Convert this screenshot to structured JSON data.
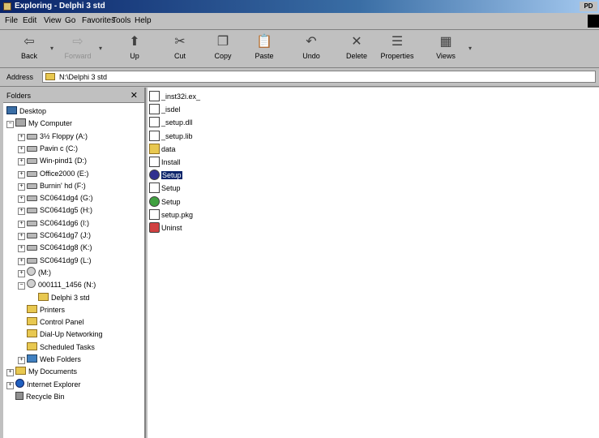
{
  "window": {
    "title": "Exploring - Delphi 3 std",
    "title_button": "PD"
  },
  "menu": [
    "File",
    "Edit",
    "View",
    "Go",
    "Favorites",
    "Tools",
    "Help"
  ],
  "toolbar": [
    {
      "label": "Back",
      "icon": "back-arrow-icon",
      "glyph": "⇦",
      "enabled": true
    },
    {
      "label": "Forward",
      "icon": "forward-arrow-icon",
      "glyph": "⇨",
      "enabled": false
    },
    {
      "label": "Up",
      "icon": "up-folder-icon",
      "glyph": "⬆",
      "enabled": true
    },
    {
      "label": "Cut",
      "icon": "scissors-icon",
      "glyph": "✂",
      "enabled": true
    },
    {
      "label": "Copy",
      "icon": "copy-icon",
      "glyph": "❐",
      "enabled": true
    },
    {
      "label": "Paste",
      "icon": "clipboard-icon",
      "glyph": "📋",
      "enabled": true
    },
    {
      "label": "Undo",
      "icon": "undo-icon",
      "glyph": "↶",
      "enabled": true
    },
    {
      "label": "Delete",
      "icon": "delete-icon",
      "glyph": "✕",
      "enabled": true
    },
    {
      "label": "Properties",
      "icon": "properties-icon",
      "glyph": "☰",
      "enabled": true
    },
    {
      "label": "Views",
      "icon": "views-icon",
      "glyph": "▦",
      "enabled": true
    }
  ],
  "address": {
    "label": "Address",
    "value": "N:\\Delphi 3 std"
  },
  "folders_pane": {
    "title": "Folders",
    "close_glyph": "✕"
  },
  "tree": [
    {
      "label": "Desktop",
      "level": 0,
      "icon": "desktop",
      "toggle": ""
    },
    {
      "label": "My Computer",
      "level": 1,
      "icon": "comp",
      "toggle": "−"
    },
    {
      "label": "3½ Floppy (A:)",
      "level": 2,
      "icon": "drv",
      "toggle": "+"
    },
    {
      "label": "Pavin c (C:)",
      "level": 2,
      "icon": "drv",
      "toggle": "+"
    },
    {
      "label": "Win-pind1 (D:)",
      "level": 2,
      "icon": "drv",
      "toggle": "+"
    },
    {
      "label": "Office2000 (E:)",
      "level": 2,
      "icon": "drv",
      "toggle": "+"
    },
    {
      "label": "Burnin' hd (F:)",
      "level": 2,
      "icon": "drv",
      "toggle": "+"
    },
    {
      "label": "SC0641dg4 (G:)",
      "level": 2,
      "icon": "drv",
      "toggle": "+"
    },
    {
      "label": "SC0641dg5 (H:)",
      "level": 2,
      "icon": "drv",
      "toggle": "+"
    },
    {
      "label": "SC0641dg6 (I:)",
      "level": 2,
      "icon": "drv",
      "toggle": "+"
    },
    {
      "label": "SC0641dg7 (J:)",
      "level": 2,
      "icon": "drv",
      "toggle": "+"
    },
    {
      "label": "SC0641dg8 (K:)",
      "level": 2,
      "icon": "drv",
      "toggle": "+"
    },
    {
      "label": "SC0641dg9 (L:)",
      "level": 2,
      "icon": "drv",
      "toggle": "+"
    },
    {
      "label": "(M:)",
      "level": 2,
      "icon": "cd",
      "toggle": "+"
    },
    {
      "label": "000111_1456 (N:)",
      "level": 2,
      "icon": "cd",
      "toggle": "−"
    },
    {
      "label": "Delphi 3 std",
      "level": 3,
      "icon": "fold",
      "toggle": ""
    },
    {
      "label": "Printers",
      "level": 2,
      "icon": "fold",
      "toggle": ""
    },
    {
      "label": "Control Panel",
      "level": 2,
      "icon": "fold",
      "toggle": ""
    },
    {
      "label": "Dial-Up Networking",
      "level": 2,
      "icon": "fold",
      "toggle": ""
    },
    {
      "label": "Scheduled Tasks",
      "level": 2,
      "icon": "fold",
      "toggle": ""
    },
    {
      "label": "Web Folders",
      "level": 2,
      "icon": "web",
      "toggle": "+"
    },
    {
      "label": "My Documents",
      "level": 1,
      "icon": "fold",
      "toggle": "+"
    },
    {
      "label": "Internet Explorer",
      "level": 1,
      "icon": "ie",
      "toggle": "+"
    },
    {
      "label": "Recycle Bin",
      "level": 1,
      "icon": "bin",
      "toggle": ""
    }
  ],
  "files": [
    {
      "name": "_inst32i.ex_",
      "icon": "doc",
      "selected": false
    },
    {
      "name": "_isdel",
      "icon": "doc",
      "selected": false
    },
    {
      "name": "_setup.dll",
      "icon": "doc",
      "selected": false
    },
    {
      "name": "_setup.lib",
      "icon": "doc",
      "selected": false
    },
    {
      "name": "data",
      "icon": "fold",
      "selected": false
    },
    {
      "name": "Install",
      "icon": "doc",
      "selected": false
    },
    {
      "name": "Setup",
      "icon": "exe",
      "selected": true
    },
    {
      "name": "Setup",
      "icon": "doc",
      "selected": false
    },
    {
      "name": "Setup",
      "icon": "cd",
      "selected": false
    },
    {
      "name": "setup.pkg",
      "icon": "doc",
      "selected": false
    },
    {
      "name": "Uninst",
      "icon": "red",
      "selected": false
    }
  ]
}
